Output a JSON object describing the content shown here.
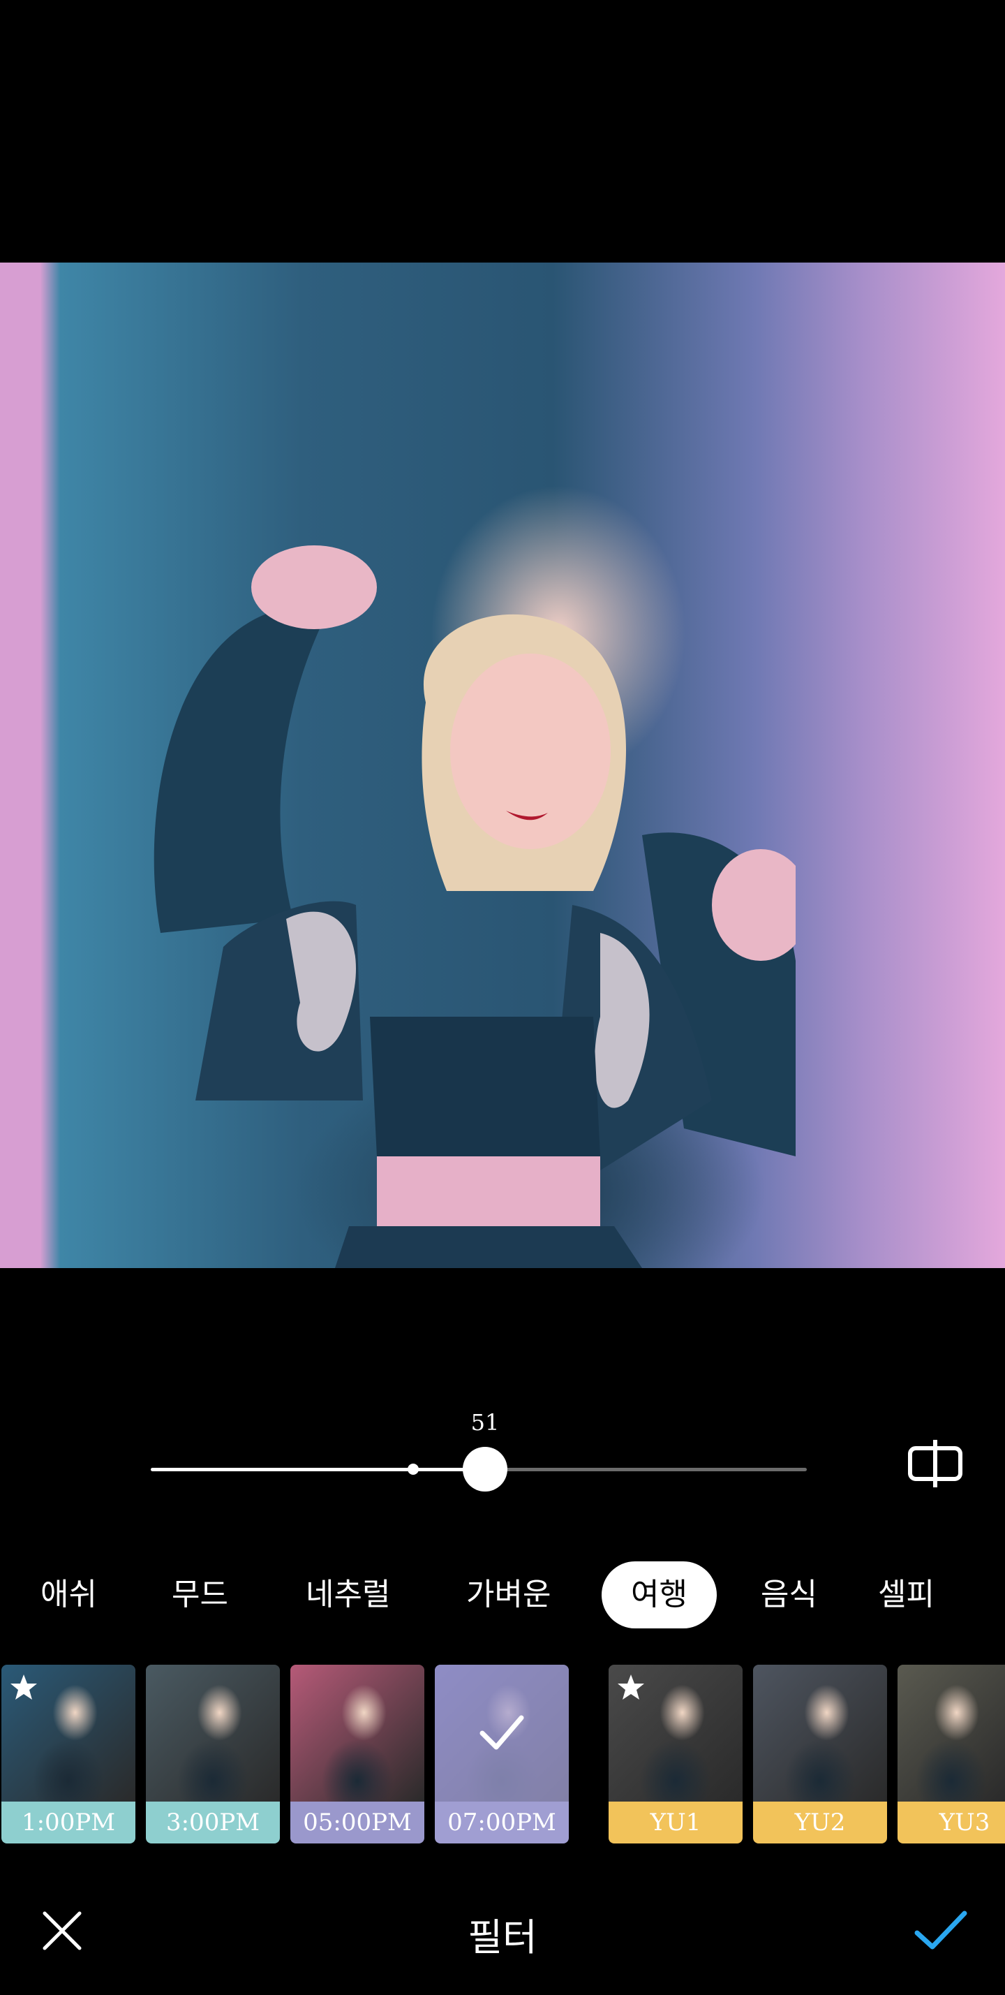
{
  "editor": {
    "slider": {
      "value_label": "51",
      "value": 51,
      "default_value": 40,
      "max": 100
    },
    "compare_icon": "compare-split-icon"
  },
  "categories": [
    {
      "label": "애쉬",
      "active": false
    },
    {
      "label": "무드",
      "active": false
    },
    {
      "label": "네추럴",
      "active": false
    },
    {
      "label": "가벼운",
      "active": false
    },
    {
      "label": "여행",
      "active": true
    },
    {
      "label": "음식",
      "active": false
    },
    {
      "label": "셀피",
      "active": false
    }
  ],
  "filters": [
    {
      "label": "1:00PM",
      "favorite": true,
      "selected": false,
      "label_color": "#8ecfcf",
      "tint": "#2a5a78"
    },
    {
      "label": "3:00PM",
      "favorite": false,
      "selected": false,
      "label_color": "#8ecfcf",
      "tint": "#4a5a62"
    },
    {
      "label": "05:00PM",
      "favorite": false,
      "selected": false,
      "label_color": "#9a98cc",
      "tint": "#b65a78"
    },
    {
      "label": "07:00PM",
      "favorite": false,
      "selected": true,
      "label_color": "#a09ed2",
      "tint": "#5a5aa0"
    },
    {
      "label": "YU1",
      "favorite": true,
      "selected": false,
      "label_color": "#f2c35a",
      "tint": "#4a4a4a"
    },
    {
      "label": "YU2",
      "favorite": false,
      "selected": false,
      "label_color": "#f2c35a",
      "tint": "#4e5560"
    },
    {
      "label": "YU3",
      "favorite": false,
      "selected": false,
      "label_color": "#f2c35a",
      "tint": "#5a5a50"
    }
  ],
  "bottom_bar": {
    "title": "필터",
    "close_icon": "close-icon",
    "confirm_icon": "checkmark-icon",
    "confirm_color": "#2aa7f0"
  }
}
